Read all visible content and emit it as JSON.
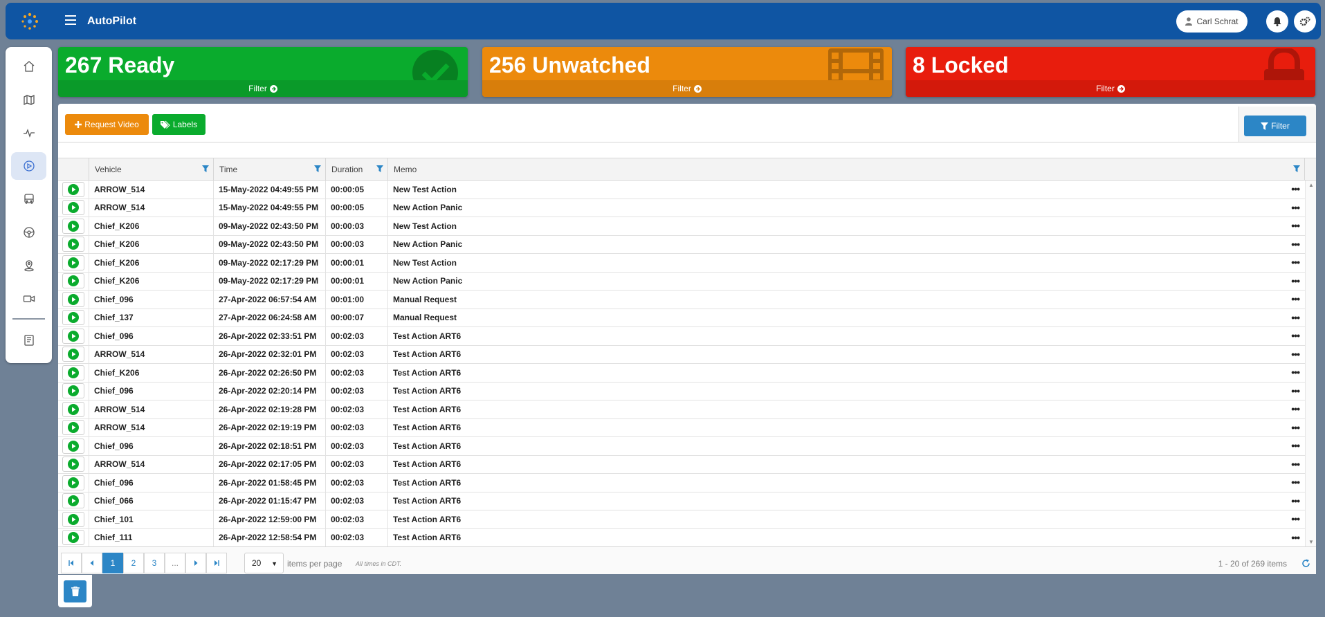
{
  "app": {
    "title": "AutoPilot"
  },
  "header": {
    "user_name": "Carl Schrat"
  },
  "sidebar": {
    "items": [
      {
        "icon": "home-icon"
      },
      {
        "icon": "map-icon"
      },
      {
        "icon": "activity-icon"
      },
      {
        "icon": "play-circle-icon",
        "active": true
      },
      {
        "icon": "bus-icon"
      },
      {
        "icon": "steering-wheel-icon"
      },
      {
        "icon": "map-pin-icon"
      },
      {
        "icon": "video-camera-icon"
      },
      {
        "icon": "book-icon"
      }
    ]
  },
  "cards": {
    "ready": {
      "label": "267 Ready",
      "filter": "Filter",
      "color": "#0aab2d"
    },
    "unwatched": {
      "label": "256 Unwatched",
      "filter": "Filter",
      "color": "#ec8a0c"
    },
    "locked": {
      "label": "8 Locked",
      "filter": "Filter",
      "color": "#e81d0d"
    }
  },
  "toolbar": {
    "request_video": "Request Video",
    "labels": "Labels",
    "filter": "Filter"
  },
  "table": {
    "columns": {
      "vehicle": "Vehicle",
      "time": "Time",
      "duration": "Duration",
      "memo": "Memo"
    },
    "rows": [
      {
        "vehicle": "ARROW_514",
        "time": "15-May-2022 04:49:55 PM",
        "duration": "00:00:05",
        "memo": "New Test Action"
      },
      {
        "vehicle": "ARROW_514",
        "time": "15-May-2022 04:49:55 PM",
        "duration": "00:00:05",
        "memo": "New Action Panic"
      },
      {
        "vehicle": "Chief_K206",
        "time": "09-May-2022 02:43:50 PM",
        "duration": "00:00:03",
        "memo": "New Test Action"
      },
      {
        "vehicle": "Chief_K206",
        "time": "09-May-2022 02:43:50 PM",
        "duration": "00:00:03",
        "memo": "New Action Panic"
      },
      {
        "vehicle": "Chief_K206",
        "time": "09-May-2022 02:17:29 PM",
        "duration": "00:00:01",
        "memo": "New Test Action"
      },
      {
        "vehicle": "Chief_K206",
        "time": "09-May-2022 02:17:29 PM",
        "duration": "00:00:01",
        "memo": "New Action Panic"
      },
      {
        "vehicle": "Chief_096",
        "time": "27-Apr-2022 06:57:54 AM",
        "duration": "00:01:00",
        "memo": "Manual Request"
      },
      {
        "vehicle": "Chief_137",
        "time": "27-Apr-2022 06:24:58 AM",
        "duration": "00:00:07",
        "memo": "Manual Request"
      },
      {
        "vehicle": "Chief_096",
        "time": "26-Apr-2022 02:33:51 PM",
        "duration": "00:02:03",
        "memo": "Test Action ART6"
      },
      {
        "vehicle": "ARROW_514",
        "time": "26-Apr-2022 02:32:01 PM",
        "duration": "00:02:03",
        "memo": "Test Action ART6"
      },
      {
        "vehicle": "Chief_K206",
        "time": "26-Apr-2022 02:26:50 PM",
        "duration": "00:02:03",
        "memo": "Test Action ART6"
      },
      {
        "vehicle": "Chief_096",
        "time": "26-Apr-2022 02:20:14 PM",
        "duration": "00:02:03",
        "memo": "Test Action ART6"
      },
      {
        "vehicle": "ARROW_514",
        "time": "26-Apr-2022 02:19:28 PM",
        "duration": "00:02:03",
        "memo": "Test Action ART6"
      },
      {
        "vehicle": "ARROW_514",
        "time": "26-Apr-2022 02:19:19 PM",
        "duration": "00:02:03",
        "memo": "Test Action ART6"
      },
      {
        "vehicle": "Chief_096",
        "time": "26-Apr-2022 02:18:51 PM",
        "duration": "00:02:03",
        "memo": "Test Action ART6"
      },
      {
        "vehicle": "ARROW_514",
        "time": "26-Apr-2022 02:17:05 PM",
        "duration": "00:02:03",
        "memo": "Test Action ART6"
      },
      {
        "vehicle": "Chief_096",
        "time": "26-Apr-2022 01:58:45 PM",
        "duration": "00:02:03",
        "memo": "Test Action ART6"
      },
      {
        "vehicle": "Chief_066",
        "time": "26-Apr-2022 01:15:47 PM",
        "duration": "00:02:03",
        "memo": "Test Action ART6"
      },
      {
        "vehicle": "Chief_101",
        "time": "26-Apr-2022 12:59:00 PM",
        "duration": "00:02:03",
        "memo": "Test Action ART6"
      },
      {
        "vehicle": "Chief_111",
        "time": "26-Apr-2022 12:58:54 PM",
        "duration": "00:02:03",
        "memo": "Test Action ART6"
      }
    ]
  },
  "pager": {
    "pages": [
      "1",
      "2",
      "3",
      "..."
    ],
    "current": "1",
    "page_size": "20",
    "items_per_page": "items per page",
    "timezone_note": "All times in CDT.",
    "summary": "1 - 20 of 269 items"
  }
}
